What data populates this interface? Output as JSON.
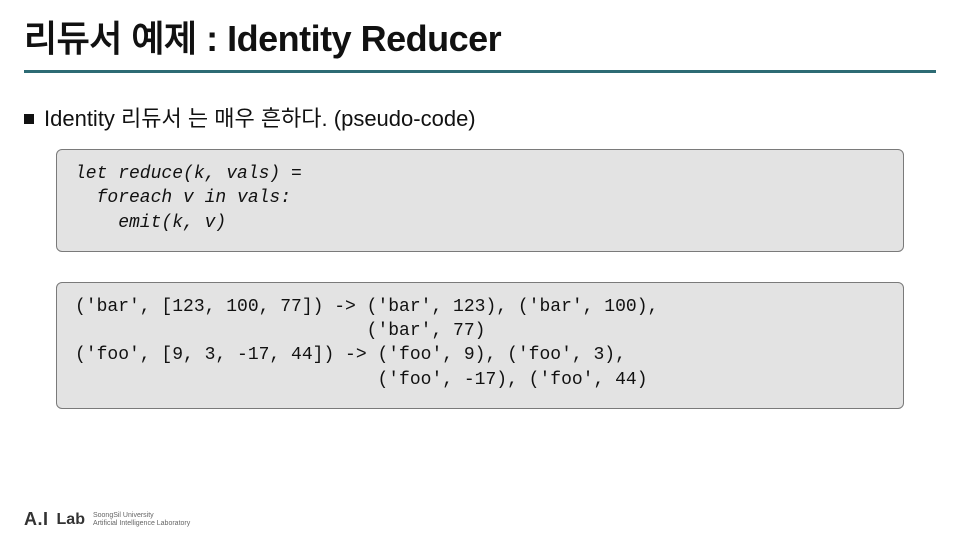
{
  "title": "리듀서 예제 : Identity Reducer",
  "sub": {
    "text": "Identity 리듀서 는 매우 흔하다. (pseudo-code)"
  },
  "code": {
    "pseudocode": "let reduce(k, vals) =\n  foreach v in vals:\n    emit(k, v)",
    "example": "('bar', [123, 100, 77]) -> ('bar', 123), ('bar', 100),\n                           ('bar', 77)\n('foo', [9, 3, -17, 44]) -> ('foo', 9), ('foo', 3),\n                            ('foo', -17), ('foo', 44)"
  },
  "footer": {
    "ai": "A.I",
    "lab": "Lab",
    "sub_line1": "SoongSil University",
    "sub_line2": "Artificial Intelligence Laboratory"
  }
}
